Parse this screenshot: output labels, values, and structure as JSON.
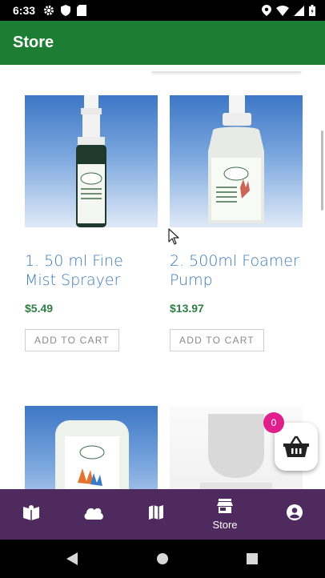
{
  "status_bar": {
    "time": "6:33"
  },
  "app_bar": {
    "title": "Store"
  },
  "products": [
    {
      "name": "1. 50 ml Fine Mist Sprayer",
      "price": "$5.49",
      "button": "ADD TO CART"
    },
    {
      "name": "2. 500ml Foamer Pump",
      "price": "$13.97",
      "button": "ADD TO CART"
    }
  ],
  "cart": {
    "count": "0"
  },
  "bottom_nav": {
    "items": [
      {
        "icon": "book-map-icon",
        "label": ""
      },
      {
        "icon": "cloud-icon",
        "label": ""
      },
      {
        "icon": "map-icon",
        "label": ""
      },
      {
        "icon": "store-icon",
        "label": "Store"
      },
      {
        "icon": "account-icon",
        "label": ""
      }
    ]
  },
  "colors": {
    "app_bar": "#1d7d33",
    "bottom_nav": "#4e2a5e",
    "price": "#2e7d43",
    "product_name": "#3b79b8",
    "badge": "#e01e8c"
  }
}
